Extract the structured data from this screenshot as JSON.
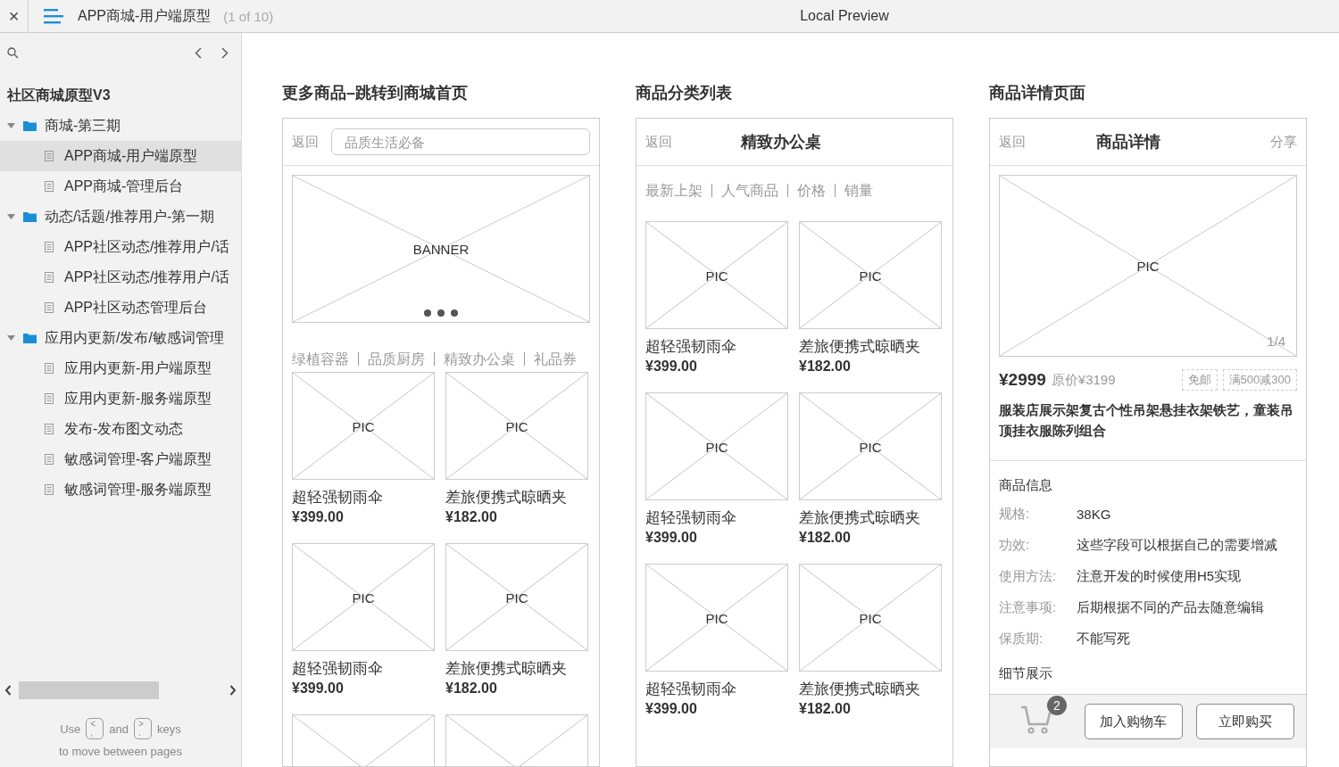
{
  "topbar": {
    "close": "×",
    "title": "APP商城-用户端原型",
    "page_count": "(1 of 10)",
    "preview_label": "Local Preview"
  },
  "sidebar": {
    "project": "社区商城原型V3",
    "tree": [
      {
        "label": "商城-第三期",
        "kind": "folder",
        "expanded": true,
        "children": [
          {
            "label": "APP商城-用户端原型",
            "kind": "page",
            "selected": true
          },
          {
            "label": "APP商城-管理后台",
            "kind": "page",
            "selected": false
          }
        ]
      },
      {
        "label": "动态/话题/推荐用户-第一期",
        "kind": "folder",
        "expanded": true,
        "children": [
          {
            "label": "APP社区动态/推荐用户/话",
            "kind": "page",
            "selected": false
          },
          {
            "label": "APP社区动态/推荐用户/话",
            "kind": "page",
            "selected": false
          },
          {
            "label": "APP社区动态管理后台",
            "kind": "page",
            "selected": false
          }
        ]
      },
      {
        "label": "应用内更新/发布/敏感词管理",
        "kind": "folder",
        "expanded": true,
        "children": [
          {
            "label": "应用内更新-用户端原型",
            "kind": "page",
            "selected": false
          },
          {
            "label": "应用内更新-服务端原型",
            "kind": "page",
            "selected": false
          },
          {
            "label": "发布-发布图文动态",
            "kind": "page",
            "selected": false
          },
          {
            "label": "敏感词管理-客户端原型",
            "kind": "page",
            "selected": false
          },
          {
            "label": "敏感词管理-服务端原型",
            "kind": "page",
            "selected": false
          }
        ]
      }
    ],
    "hint": {
      "use": "Use",
      "key_1": [
        "<",
        ","
      ],
      "and": "and",
      "key_2": [
        ">",
        "."
      ],
      "keys": "keys",
      "line_2": "to move between pages"
    }
  },
  "screens": [
    {
      "title": "更多商品–跳转到商城首页",
      "header": {
        "back": "返回",
        "search_placeholder": "品质生活必备"
      },
      "banner": {
        "label": "BANNER"
      },
      "categories": [
        "绿植容器",
        "品质厨房",
        "精致办公桌",
        "礼品券"
      ],
      "products": [
        {
          "kind": "card",
          "image_label": "PIC",
          "name": "超轻强韧雨伞",
          "price": "¥399.00"
        },
        {
          "kind": "card",
          "image_label": "PIC",
          "name": "差旅便携式晾晒夹",
          "price": "¥182.00"
        },
        {
          "kind": "card",
          "image_label": "PIC",
          "name": "超轻强韧雨伞",
          "price": "¥399.00"
        },
        {
          "kind": "card",
          "image_label": "PIC",
          "name": "差旅便携式晾晒夹",
          "price": "¥182.00"
        },
        {
          "kind": "cut"
        },
        {
          "kind": "cut"
        }
      ]
    },
    {
      "title": "商品分类列表",
      "header": {
        "back": "返回",
        "title": "精致办公桌"
      },
      "categories": [
        "最新上架",
        "人气商品",
        "价格",
        "销量"
      ],
      "products": [
        {
          "kind": "card",
          "image_label": "PIC",
          "name": "超轻强韧雨伞",
          "price": "¥399.00"
        },
        {
          "kind": "card",
          "image_label": "PIC",
          "name": "差旅便携式晾晒夹",
          "price": "¥182.00"
        },
        {
          "kind": "card",
          "image_label": "PIC",
          "name": "超轻强韧雨伞",
          "price": "¥399.00"
        },
        {
          "kind": "card",
          "image_label": "PIC",
          "name": "差旅便携式晾晒夹",
          "price": "¥182.00"
        },
        {
          "kind": "card",
          "image_label": "PIC",
          "name": "超轻强韧雨伞",
          "price": "¥399.00"
        },
        {
          "kind": "card",
          "image_label": "PIC",
          "name": "差旅便携式晾晒夹",
          "price": "¥182.00"
        }
      ]
    },
    {
      "title": "商品详情页面",
      "header": {
        "back": "返回",
        "title": "商品详情",
        "share": "分享"
      },
      "detail": {
        "image_label": "PIC",
        "image_index": "1/4",
        "price": "¥2999",
        "original_price": "原价¥3199",
        "tags": [
          "免邮",
          "满500减300"
        ],
        "name": "服装店展示架复古个性吊架悬挂衣架铁艺，童装吊顶挂衣服陈列组合",
        "info_title": "商品信息",
        "specs": [
          {
            "label": "规格:",
            "value": "38KG"
          },
          {
            "label": "功效:",
            "value": "这些字段可以根据自己的需要增减"
          },
          {
            "label": "使用方法:",
            "value": "注意开发的时候使用H5实现"
          },
          {
            "label": "注意事项:",
            "value": "后期根据不同的产品去随意编辑"
          },
          {
            "label": "保质期:",
            "value": "不能写死"
          }
        ],
        "details_title": "细节展示",
        "cart_count": "2",
        "buttons": [
          "加入购物车",
          "立即购买"
        ]
      }
    }
  ]
}
